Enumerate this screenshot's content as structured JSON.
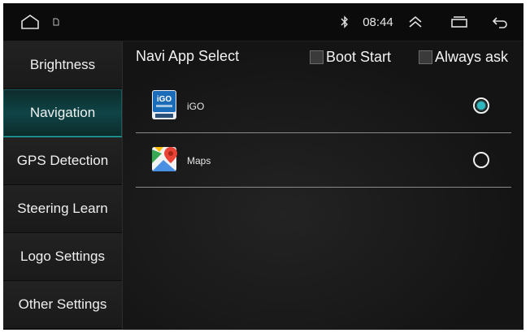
{
  "statusbar": {
    "time": "08:44",
    "icons": [
      "home-icon",
      "sd-card-icon",
      "bluetooth-icon",
      "expand-up-icon",
      "recent-apps-icon",
      "back-icon"
    ]
  },
  "sidebar": {
    "items": [
      {
        "label": "Brightness",
        "active": false
      },
      {
        "label": "Navigation",
        "active": true
      },
      {
        "label": "GPS Detection",
        "active": false
      },
      {
        "label": "Steering Learn",
        "active": false
      },
      {
        "label": "Logo Settings",
        "active": false
      },
      {
        "label": "Other Settings",
        "active": false
      }
    ]
  },
  "main": {
    "title": "Navi App Select",
    "boot_start": {
      "label": "Boot Start",
      "checked": false
    },
    "always_ask": {
      "label": "Always ask",
      "checked": false
    },
    "apps": [
      {
        "name": "iGO",
        "icon": "igo-app-icon",
        "selected": true
      },
      {
        "name": "Maps",
        "icon": "google-maps-icon",
        "selected": false
      }
    ]
  },
  "colors": {
    "accent": "#16b7b4",
    "background": "#141414",
    "sidebar": "#1e1e1e"
  }
}
